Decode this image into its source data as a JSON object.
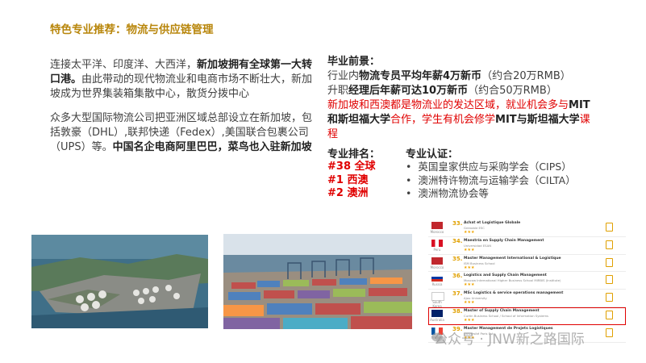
{
  "title": "特色专业推荐：物流与供应链管理",
  "left": {
    "p1_a": "连接太平洋、印度洋、大西洋，",
    "p1_b": "新加坡拥有全球第一大转口港。",
    "p1_c": "由此带动的现代物流业和电商市场不断壮大，新加坡成为世界集装箱集散中心，散货分拨中心",
    "p2_a": "众多大型国际物流公司把亚洲区域总部设立在新加坡，包括敦豪（DHL）,联邦快递（Fedex）,美国联合包裹公司（UPS）等。",
    "p2_b": "中国名企电商阿里巴巴，菜鸟也入驻新加坡"
  },
  "prospects": {
    "heading": "毕业前景：",
    "line1_a": "行业内",
    "line1_b": "物流专员平均年薪4万新币",
    "line1_c": "（约合20万RMB）",
    "line2_a": "升职",
    "line2_b": "经理后年薪可达10万新币",
    "line2_c": "（约合50万RMB）",
    "red_a": "新加坡和西澳都是物流业的发达区域，就业机会多与",
    "red_b": "MIT和斯坦福大学",
    "red_c": "合作，学生有机会修学",
    "red_d": "MIT与斯坦福大学",
    "red_e": "课程"
  },
  "ranking": {
    "heading": "专业排名：",
    "items": [
      "#38 全球",
      "#1 西澳",
      "#2 澳洲"
    ]
  },
  "certification": {
    "heading": "专业认证：",
    "items": [
      "英国皇家供应与采购学会（CIPS）",
      "澳洲特许物流与运输学会（CILTA）",
      "澳洲物流协会等"
    ]
  },
  "ranking_list": [
    {
      "num": "33.",
      "name": "Achat et Logistique Globale",
      "school": "Grenoble ESC",
      "country": "Morocco",
      "stars": "★★★"
    },
    {
      "num": "34.",
      "name": "Maestría en Supply Chain Management",
      "school": "Universidad ESAN",
      "country": "Peru",
      "stars": "★★★"
    },
    {
      "num": "35.",
      "name": "Master Management International & Logistique",
      "school": "ISM Business School",
      "country": "Morocco",
      "stars": "★★★"
    },
    {
      "num": "36.",
      "name": "Logistics and Supply Chain Management",
      "school": "Moscow International Higher Business School MIRBIS (Institute)",
      "country": "Russia",
      "stars": "★★★"
    },
    {
      "num": "37.",
      "name": "MSc Logistics & service operations management",
      "school": "Ajou University",
      "country": "South Korea",
      "stars": "★★★"
    },
    {
      "num": "38.",
      "name": "Master of Supply Chain Management",
      "school": "Curtin Business School / School of Information Systems",
      "country": "Australia",
      "stars": "★★★"
    },
    {
      "num": "39.",
      "name": "Master Management de Projets Logistiques",
      "school": "Université Paris Est",
      "country": "France",
      "stars": "★★★"
    }
  ],
  "watermark": "公众号 · JNW新之路国际",
  "colors": {
    "title": "#b8860b",
    "red": "#e00000",
    "star": "#f0a500"
  }
}
